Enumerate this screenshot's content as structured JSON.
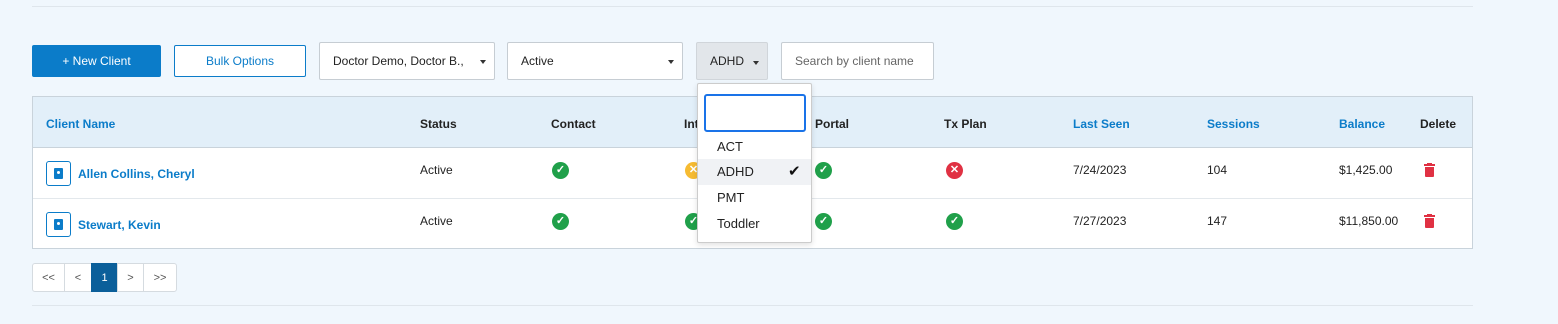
{
  "toolbar": {
    "new_client_label": "+ New Client",
    "bulk_options_label": "Bulk Options",
    "doctor_select_value": "Doctor Demo, Doctor B.,",
    "status_select_value": "Active",
    "tag_filter_label": "ADHD",
    "search_placeholder": "Search by client name"
  },
  "table": {
    "headers": {
      "client_name": "Client Name",
      "status": "Status",
      "contact": "Contact",
      "intake": "Int",
      "portal": "Portal",
      "tx_plan": "Tx Plan",
      "last_seen": "Last Seen",
      "sessions": "Sessions",
      "balance": "Balance",
      "delete": "Delete"
    },
    "rows": [
      {
        "client_name": "Allen Collins, Cheryl",
        "status": "Active",
        "contact": "ok",
        "intake": "warning",
        "portal": "ok",
        "tx_plan": "error",
        "last_seen": "7/24/2023",
        "sessions": "104",
        "balance": "$1,425.00"
      },
      {
        "client_name": "Stewart, Kevin",
        "status": "Active",
        "contact": "ok",
        "intake": "ok",
        "portal": "ok",
        "tx_plan": "ok",
        "last_seen": "7/27/2023",
        "sessions": "147",
        "balance": "$11,850.00"
      }
    ]
  },
  "pagination": {
    "first": "<<",
    "prev": "<",
    "current": "1",
    "next": ">",
    "last": ">>"
  },
  "tag_dropdown": {
    "search_value": "",
    "options": [
      {
        "label": "ACT",
        "selected": false
      },
      {
        "label": "ADHD",
        "selected": true
      },
      {
        "label": "PMT",
        "selected": false
      },
      {
        "label": "Toddler",
        "selected": false
      }
    ],
    "check_glyph": "✔"
  },
  "colors": {
    "primary": "#0b7cc9",
    "ok": "#20a04a",
    "error": "#e03143",
    "warning": "#f6bb32",
    "pager_active": "#0b5f9a"
  }
}
